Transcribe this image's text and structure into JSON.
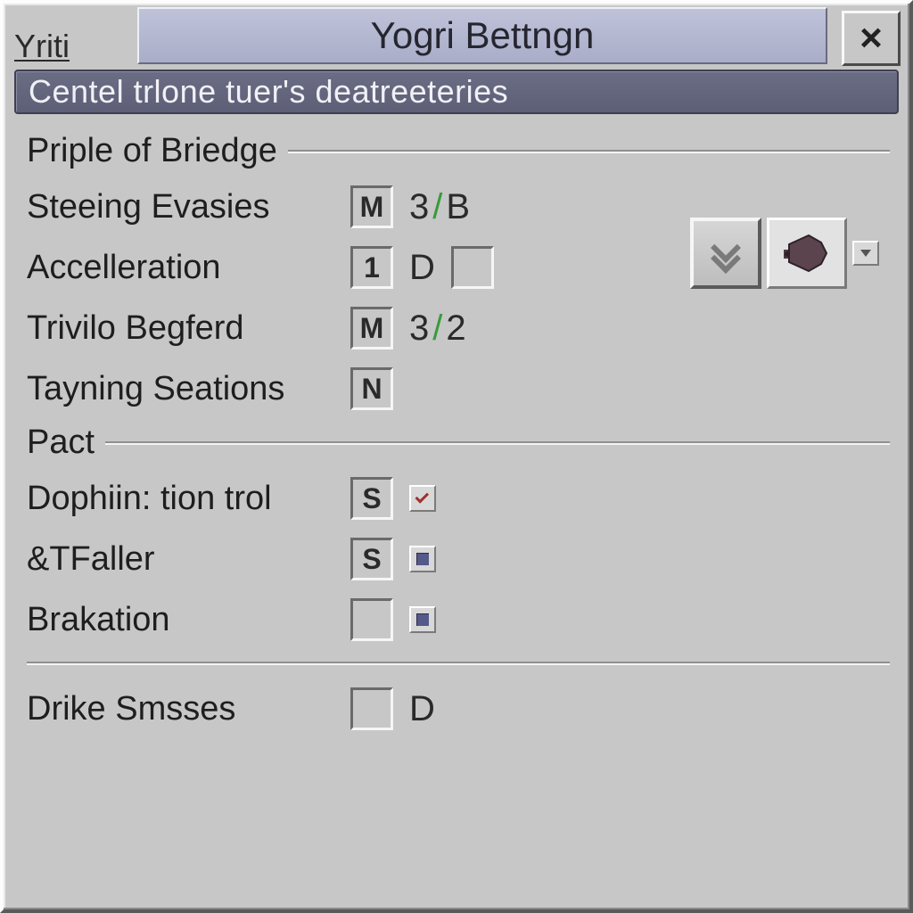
{
  "window": {
    "corner_label": "Yriti",
    "title": "Yogri Bettngn",
    "banner": "Centel trlone tuer's deatreeteries"
  },
  "group1": {
    "title": "Priple of Briedge",
    "rows": {
      "steeing": {
        "label": "Steeing Evasies",
        "code": "M",
        "ratio_a": "3",
        "ratio_b": "B"
      },
      "accel": {
        "label": "Accelleration",
        "code": "1",
        "aux": "D"
      },
      "trivilo": {
        "label": "Trivilo Begferd",
        "code": "M",
        "ratio_a": "3",
        "ratio_b": "2"
      },
      "tayning": {
        "label": "Tayning Seations",
        "code": "N"
      }
    }
  },
  "group2": {
    "title": "Pact",
    "rows": {
      "dophin": {
        "label": "Dophiin: tion trol",
        "code": "S"
      },
      "tfaller": {
        "label": "&TFaller",
        "code": "S"
      },
      "brak": {
        "label": "Brakation",
        "code": ""
      }
    }
  },
  "group3": {
    "rows": {
      "drike": {
        "label": "Drike Smsses",
        "code": "",
        "aux": "D"
      }
    }
  },
  "icons": {
    "close": "×",
    "chevrons": "double-chevron-down",
    "speaker": "speaker-icon",
    "drop": "dropdown-arrow"
  },
  "colors": {
    "bg": "#c6c7c6",
    "banner": "#63657c",
    "accent_slash": "#3a9a3a",
    "titlebar": "#b4b8d0"
  }
}
